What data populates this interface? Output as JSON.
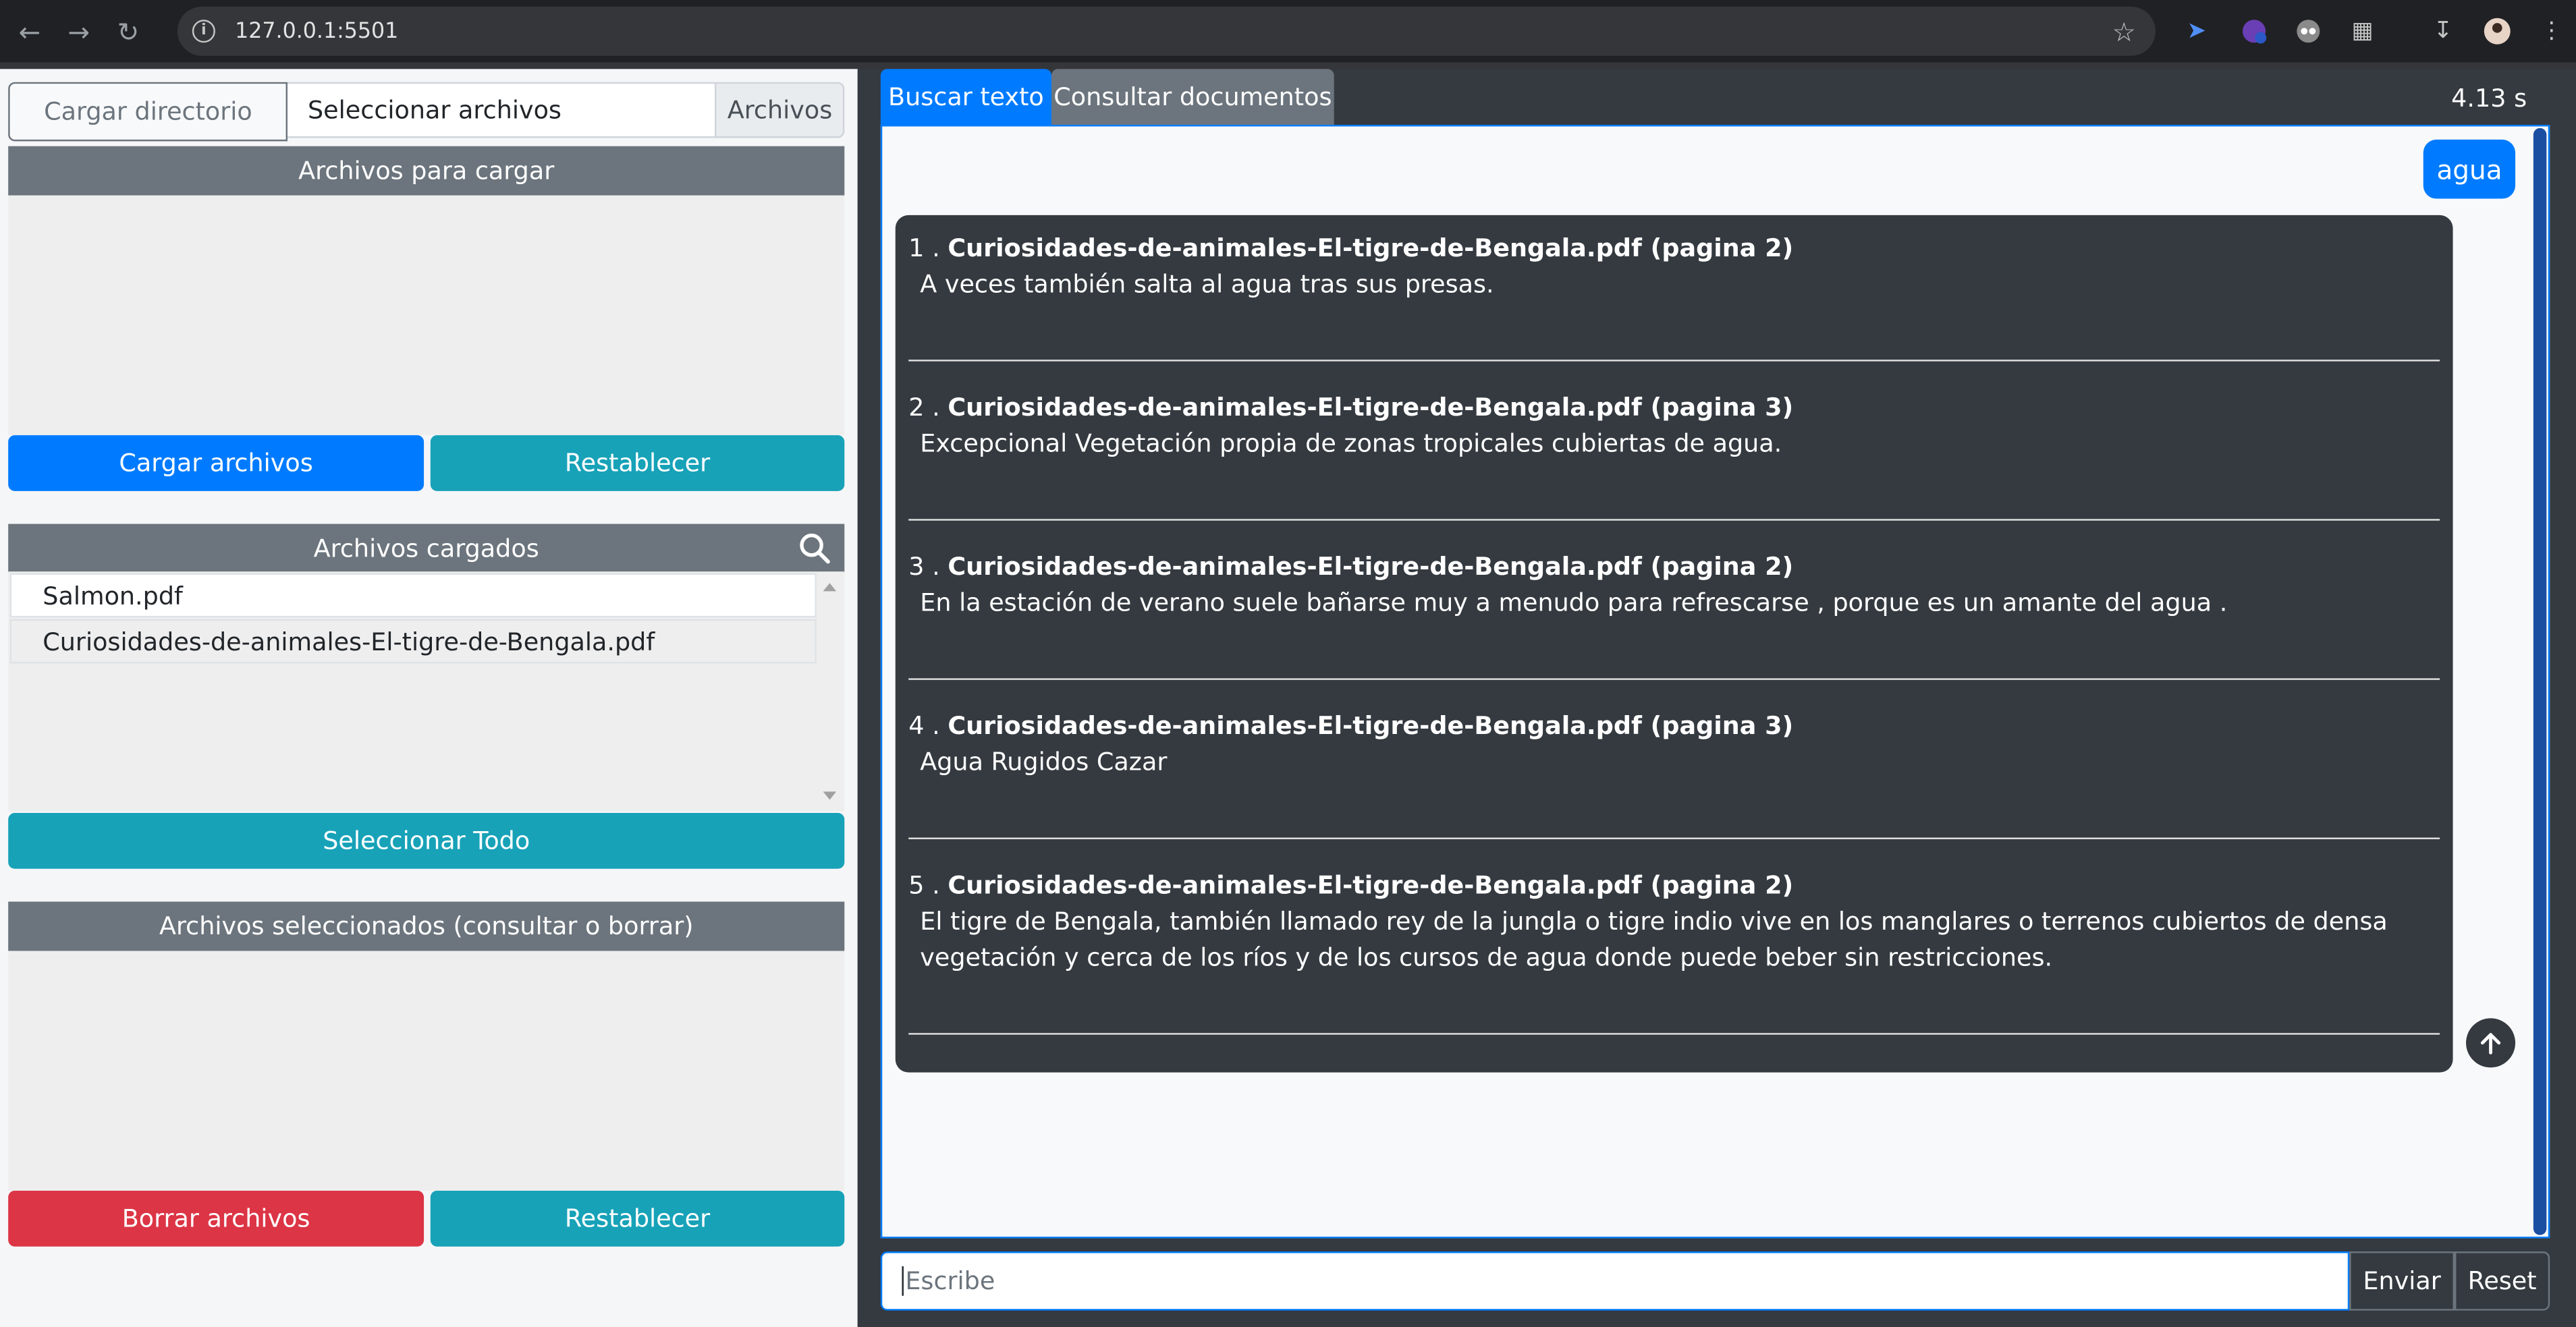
{
  "browser": {
    "url": "127.0.0.1:5501"
  },
  "left": {
    "upload": {
      "dir_button": "Cargar directorio",
      "file_input_text": "Seleccionar archivos",
      "files_label": "Archivos"
    },
    "to_upload": {
      "header": "Archivos para cargar",
      "load_button": "Cargar archivos",
      "reset_button": "Restablecer"
    },
    "loaded": {
      "header": "Archivos cargados",
      "files": [
        "Salmon.pdf",
        "Curiosidades-de-animales-El-tigre-de-Bengala.pdf"
      ],
      "select_all_button": "Seleccionar Todo"
    },
    "selected": {
      "header": "Archivos seleccionados (consultar o borrar)",
      "delete_button": "Borrar archivos",
      "reset_button": "Restablecer"
    }
  },
  "right": {
    "tabs": [
      {
        "label": "Buscar texto",
        "active": true
      },
      {
        "label": "Consultar documentos",
        "active": false
      }
    ],
    "timing": "4.13 s",
    "query": "agua",
    "results": [
      {
        "num": "1 .",
        "title": "Curiosidades-de-animales-El-tigre-de-Bengala.pdf (pagina 2)",
        "text": "A veces también salta al agua tras sus presas."
      },
      {
        "num": "2 .",
        "title": "Curiosidades-de-animales-El-tigre-de-Bengala.pdf (pagina 3)",
        "text": "Excepcional Vegetación propia de zonas tropicales cubiertas de agua."
      },
      {
        "num": "3 .",
        "title": "Curiosidades-de-animales-El-tigre-de-Bengala.pdf (pagina 2)",
        "text": "En la estación de verano suele bañarse muy a menudo para refrescarse , porque es un amante del agua ."
      },
      {
        "num": "4 .",
        "title": "Curiosidades-de-animales-El-tigre-de-Bengala.pdf (pagina 3)",
        "text": "Agua Rugidos Cazar"
      },
      {
        "num": "5 .",
        "title": "Curiosidades-de-animales-El-tigre-de-Bengala.pdf (pagina 2)",
        "text": "El tigre de Bengala, también llamado rey de la jungla o tigre indio vive en los manglares o terrenos cubiertos de densa vegetación y cerca de los ríos y de los cursos de agua donde puede beber sin restricciones."
      }
    ],
    "input": {
      "placeholder": "Escribe",
      "send_button": "Enviar",
      "reset_button": "Reset"
    }
  },
  "colors": {
    "primary": "#007bff",
    "info": "#17a2b8",
    "danger": "#dc3545",
    "secondary": "#6c757d",
    "dark": "#343a40"
  }
}
